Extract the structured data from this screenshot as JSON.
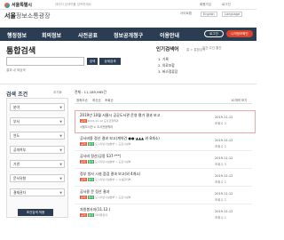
{
  "header": {
    "org": "서울특별시",
    "top_links": [
      "회원가입",
      "로그인"
    ],
    "search_placeholder": "데이터 검색어를 입력하세요",
    "site_title_bold": "서울",
    "site_title_rest": "정보소통광장",
    "util_links": [
      "사이트맵",
      "English",
      "Language"
    ]
  },
  "nav": {
    "items": [
      "행정정보",
      "회의정보",
      "사전공표",
      "정보공개청구",
      "이용안내"
    ],
    "login": "로그인",
    "myinfo": "나의정보확인"
  },
  "page": {
    "title": "통합검색",
    "breadcrumb": "홈 > 통합검색",
    "search_value": "",
    "search_button": "검색",
    "detail_button": "상세검색",
    "search_hint": "결과 내 재검색"
  },
  "popular": {
    "title": "인기검색어",
    "tabs": "일간 주간 월간",
    "items": [
      "1. 기록",
      "2. 의료조합",
      "3. 버스정류장"
    ]
  },
  "filter": {
    "title": "검색 조건",
    "reset": "초기화",
    "rows": [
      "분야",
      "부서",
      "연도",
      "공개여부",
      "기관",
      "문서유형",
      "결재권자"
    ],
    "apply": "조건검색 적용"
  },
  "results": {
    "count_text": "전체 : 11,189,965건",
    "sort_links": [
      "정확도순",
      "최신순",
      "조회순"
    ],
    "sort_dropdown": "10개씩 보기",
    "items": [
      {
        "title": "2019년 10월 서울시 공공도서관 운영 평가 결과 보고",
        "tags": [
          {
            "text": "공개",
            "color": "red"
          }
        ],
        "meta": "2019-11-12 도서관정책과",
        "sub": "서울도서관 > 도서관정책과",
        "date": "2019-11-12",
        "views": "조회수 2"
      },
      {
        "title": "공사비용 정산 결과 보고(계약건 ●●-▲▲▲ 외 8개소)",
        "tags": [
          {
            "text": "공개",
            "color": "red"
          },
          {
            "text": "결재",
            "color": "green"
          }
        ],
        "meta": "도시기반시설본부 > 도로시설부",
        "sub": "",
        "date": "2019-11-12",
        "views": "조회수 2"
      },
      {
        "title": "공사비 정산(공정 S37-***)",
        "tags": [
          {
            "text": "공개",
            "color": "red"
          },
          {
            "text": "결재",
            "color": "green"
          }
        ],
        "meta": "도시기반시설본부 > 도로시설부",
        "sub": "",
        "date": "2019-11-12",
        "views": "조회수 3"
      },
      {
        "title": "정부 청사 시설 점검 결과 보고(외 4개소)",
        "tags": [
          {
            "text": "공개",
            "color": "red"
          },
          {
            "text": "결재",
            "color": "green"
          }
        ],
        "meta": "도시기반시설본부 > 시설관리부",
        "sub": "",
        "date": "2019-11-12",
        "views": "조회수 2"
      },
      {
        "title": "공사용 문 정산 결과",
        "tags": [
          {
            "text": "공개",
            "color": "red"
          },
          {
            "text": "결재",
            "color": "green"
          }
        ],
        "meta": "도시기반시설본부 > 도로시설부",
        "sub": "",
        "date": "2019-11-12",
        "views": "조회수 1"
      },
      {
        "title": "자원봉사자(11.12.)",
        "tags": [
          {
            "text": "공개",
            "color": "red"
          },
          {
            "text": "결재",
            "color": "green"
          }
        ],
        "meta": "자치행정과",
        "sub": "",
        "date": "2019-11-12",
        "views": "조회수 1"
      }
    ]
  }
}
